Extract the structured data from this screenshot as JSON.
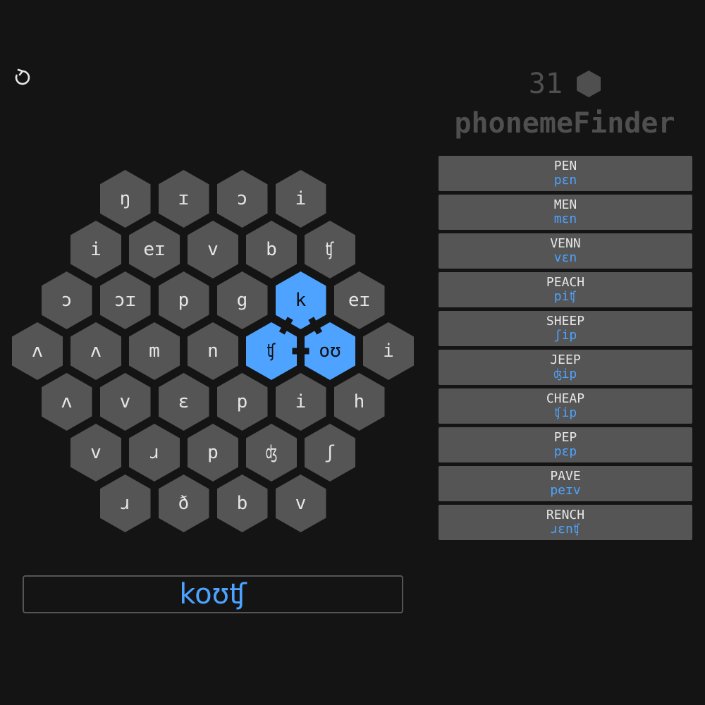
{
  "app": {
    "title": "phonemeFinder"
  },
  "reset": {
    "icon": "reset-icon"
  },
  "score": {
    "value": "31",
    "icon": "hexagon-icon"
  },
  "colors": {
    "selected": "#4da3ff",
    "cell": "#555555",
    "background": "#141414"
  },
  "board": {
    "rows": [
      [
        "ŋ",
        "ɪ",
        "ɔ",
        "i"
      ],
      [
        "i",
        "eɪ",
        "v",
        "b",
        "ʧ"
      ],
      [
        "ɔ",
        "ɔɪ",
        "p",
        "g",
        "k",
        "eɪ"
      ],
      [
        "ʌ",
        "ʌ",
        "m",
        "n",
        "ʧ",
        "oʊ",
        "i"
      ],
      [
        "ʌ",
        "v",
        "ɛ",
        "p",
        "i",
        "h"
      ],
      [
        "v",
        "ɹ",
        "p",
        "ʤ",
        "ʃ"
      ],
      [
        "ɹ",
        "ð",
        "b",
        "v"
      ]
    ],
    "selected": [
      [
        2,
        4
      ],
      [
        3,
        4
      ],
      [
        3,
        5
      ]
    ]
  },
  "current_word": "koʊʧ",
  "found_words": [
    {
      "word": "PEN",
      "ipa": "pɛn"
    },
    {
      "word": "MEN",
      "ipa": "mɛn"
    },
    {
      "word": "VENN",
      "ipa": "vɛn"
    },
    {
      "word": "PEACH",
      "ipa": "piʧ"
    },
    {
      "word": "SHEEP",
      "ipa": "ʃip"
    },
    {
      "word": "JEEP",
      "ipa": "ʤip"
    },
    {
      "word": "CHEAP",
      "ipa": "ʧip"
    },
    {
      "word": "PEP",
      "ipa": "pɛp"
    },
    {
      "word": "PAVE",
      "ipa": "peɪv"
    },
    {
      "word": "RENCH",
      "ipa": "ɹɛnʧ"
    }
  ]
}
